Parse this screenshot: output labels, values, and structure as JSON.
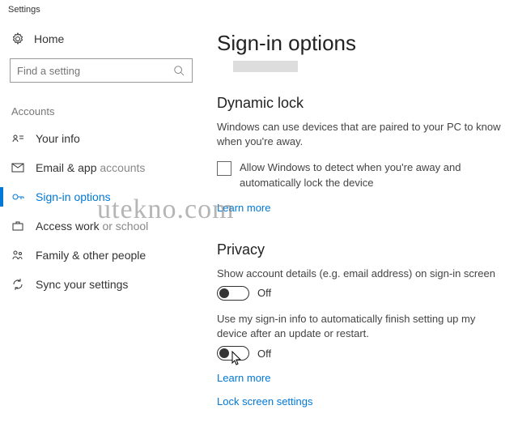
{
  "window": {
    "title": "Settings"
  },
  "sidebar": {
    "home": "Home",
    "search_placeholder": "Find a setting",
    "section": "Accounts",
    "items": [
      {
        "label": "Your info"
      },
      {
        "label_a": "Email & app",
        "label_b": " accounts"
      },
      {
        "label": "Sign-in options"
      },
      {
        "label_a": "Access work",
        "label_b": " or school"
      },
      {
        "label": "Family & other people"
      },
      {
        "label": "Sync your settings"
      }
    ]
  },
  "main": {
    "title": "Sign-in options",
    "dynamic_lock": {
      "heading": "Dynamic lock",
      "desc": "Windows can use devices that are paired to your PC to know when you're away.",
      "checkbox_label": "Allow Windows to detect when you're away and automatically lock the device",
      "learn_more": "Learn more"
    },
    "privacy": {
      "heading": "Privacy",
      "opt1_label": "Show account details (e.g. email address) on sign-in screen",
      "opt1_state": "Off",
      "opt2_label": "Use my sign-in info to automatically finish setting up my device after an update or restart.",
      "opt2_state": "Off",
      "learn_more": "Learn more",
      "lock_screen": "Lock screen settings"
    }
  },
  "watermark": "utekno.com"
}
